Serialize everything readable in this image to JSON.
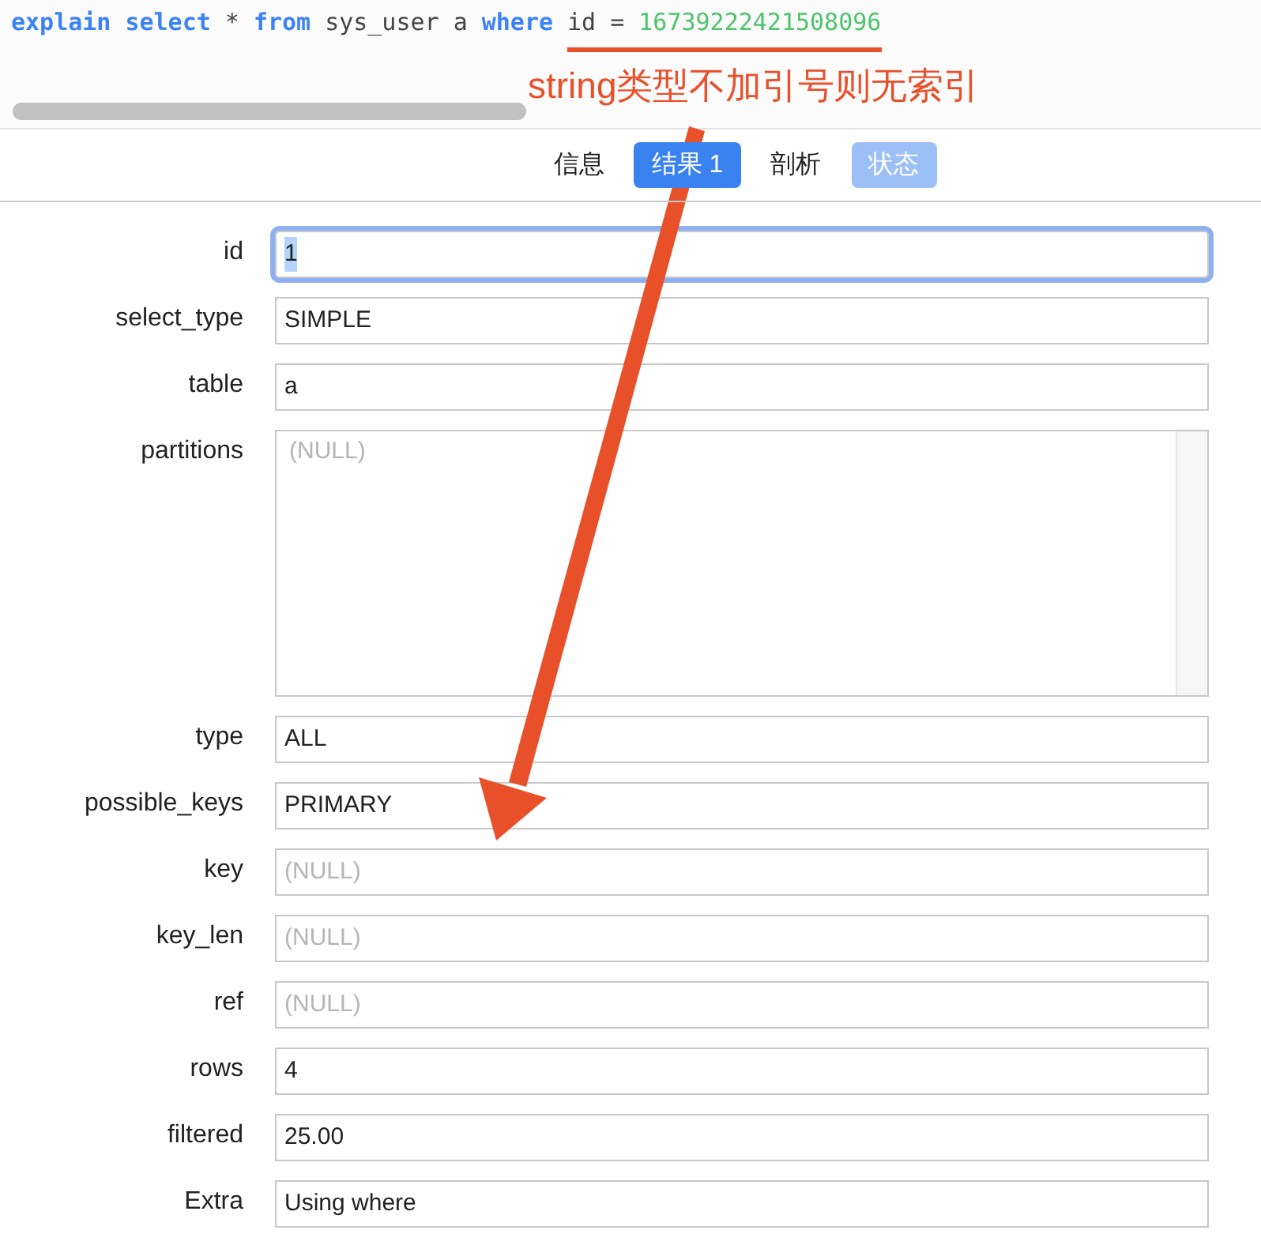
{
  "query": {
    "tokens": [
      {
        "kind": "keyword",
        "text": "explain"
      },
      {
        "kind": "keyword",
        "text": "select"
      },
      {
        "kind": "plain",
        "text": "*"
      },
      {
        "kind": "keyword",
        "text": "from"
      },
      {
        "kind": "plain",
        "text": "sys_user a"
      },
      {
        "kind": "keyword",
        "text": "where"
      },
      {
        "kind": "plain",
        "text": "id ="
      },
      {
        "kind": "number",
        "text": "16739222421508096"
      }
    ]
  },
  "annotation": {
    "text": "string类型不加引号则无索引"
  },
  "tabs": [
    {
      "label": "信息",
      "selected": false,
      "disabled": false
    },
    {
      "label": "结果 1",
      "selected": true,
      "disabled": false
    },
    {
      "label": "剖析",
      "selected": false,
      "disabled": false
    },
    {
      "label": "状态",
      "selected": false,
      "disabled": true
    }
  ],
  "fields": [
    {
      "label": "id",
      "value": "1",
      "kind": "line",
      "focused": true
    },
    {
      "label": "select_type",
      "value": "SIMPLE",
      "kind": "line",
      "focused": false
    },
    {
      "label": "table",
      "value": "a",
      "kind": "line",
      "focused": false
    },
    {
      "label": "partitions",
      "placeholder": "(NULL)",
      "kind": "area",
      "focused": false
    },
    {
      "label": "type",
      "value": "ALL",
      "kind": "line",
      "focused": false
    },
    {
      "label": "possible_keys",
      "value": "PRIMARY",
      "kind": "line",
      "focused": false
    },
    {
      "label": "key",
      "placeholder": "(NULL)",
      "kind": "line",
      "focused": false
    },
    {
      "label": "key_len",
      "placeholder": "(NULL)",
      "kind": "line",
      "focused": false
    },
    {
      "label": "ref",
      "placeholder": "(NULL)",
      "kind": "line",
      "focused": false
    },
    {
      "label": "rows",
      "value": "4",
      "kind": "line",
      "focused": false
    },
    {
      "label": "filtered",
      "value": "25.00",
      "kind": "line",
      "focused": false
    },
    {
      "label": "Extra",
      "value": "Using where",
      "kind": "line",
      "focused": false
    }
  ]
}
